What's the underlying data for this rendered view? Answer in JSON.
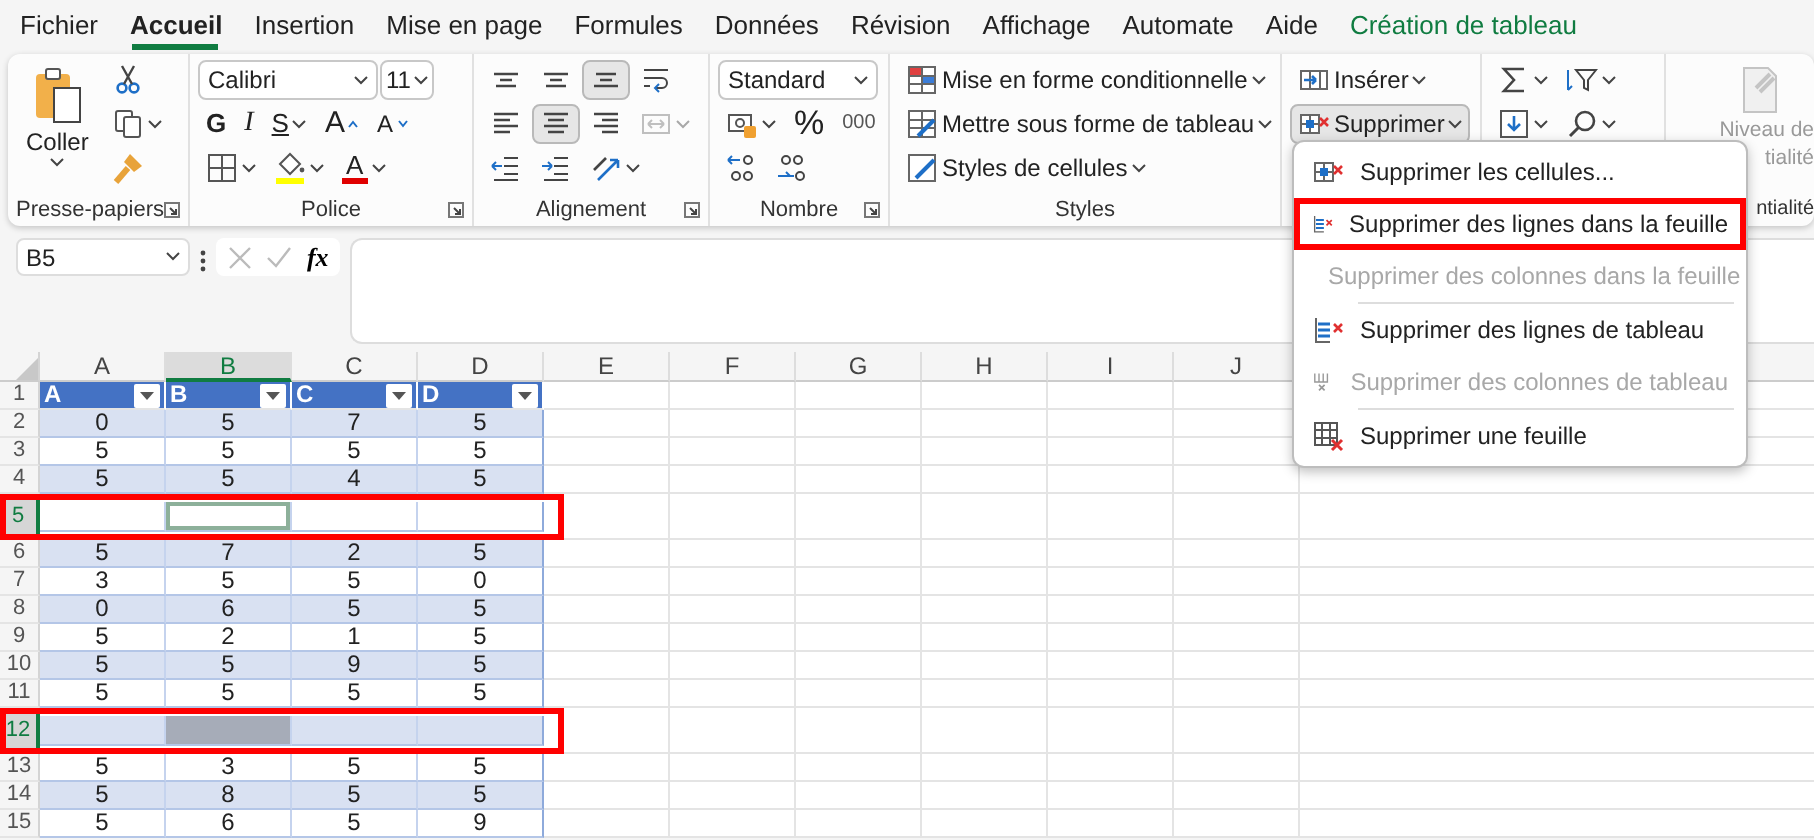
{
  "ribbon_tabs": [
    {
      "label": "Fichier",
      "selected": false,
      "kind": "standard"
    },
    {
      "label": "Accueil",
      "selected": true,
      "kind": "standard"
    },
    {
      "label": "Insertion",
      "selected": false,
      "kind": "standard"
    },
    {
      "label": "Mise en page",
      "selected": false,
      "kind": "standard"
    },
    {
      "label": "Formules",
      "selected": false,
      "kind": "standard"
    },
    {
      "label": "Données",
      "selected": false,
      "kind": "standard"
    },
    {
      "label": "Révision",
      "selected": false,
      "kind": "standard"
    },
    {
      "label": "Affichage",
      "selected": false,
      "kind": "standard"
    },
    {
      "label": "Automate",
      "selected": false,
      "kind": "standard"
    },
    {
      "label": "Aide",
      "selected": false,
      "kind": "standard"
    },
    {
      "label": "Création de tableau",
      "selected": false,
      "kind": "contextual"
    }
  ],
  "clipboard": {
    "paste_label": "Coller",
    "tools": [
      {
        "kind": "cut",
        "caret": false
      },
      {
        "kind": "copy",
        "caret": true
      },
      {
        "kind": "format-painter",
        "caret": false
      }
    ],
    "group_label": "Presse-papiers",
    "launcher": true
  },
  "font": {
    "name": "Calibri",
    "size": "11",
    "rows": [
      [
        {
          "kind": "bold",
          "label": "G",
          "caret": false
        },
        {
          "kind": "italic",
          "label": "I",
          "caret": false
        },
        {
          "kind": "underline",
          "label": "S",
          "caret": true
        },
        {
          "kind": "grow",
          "label": "A",
          "caret": false
        },
        {
          "kind": "shrink",
          "label": "A",
          "caret": false
        }
      ],
      [
        {
          "kind": "borders",
          "caret": true
        },
        {
          "kind": "fill-color",
          "caret": true
        },
        {
          "kind": "font-color",
          "label": "A",
          "caret": true
        }
      ]
    ],
    "group_label": "Police",
    "launcher": true
  },
  "alignment": {
    "rows": [
      [
        {
          "kind": "align-top",
          "caret": false,
          "selected": false,
          "disabled": false
        },
        {
          "kind": "align-middle",
          "caret": false,
          "selected": false,
          "disabled": false
        },
        {
          "kind": "align-bottom",
          "caret": false,
          "selected": true,
          "disabled": false
        },
        {
          "kind": "wrap",
          "caret": false,
          "selected": false,
          "disabled": false
        }
      ],
      [
        {
          "kind": "align-left",
          "caret": false,
          "selected": false,
          "disabled": false
        },
        {
          "kind": "align-center",
          "caret": false,
          "selected": true,
          "disabled": false
        },
        {
          "kind": "align-right",
          "caret": false,
          "selected": false,
          "disabled": false
        },
        {
          "kind": "merge",
          "caret": true,
          "selected": false,
          "disabled": true
        }
      ],
      [
        {
          "kind": "outdent",
          "caret": false,
          "selected": false,
          "disabled": false
        },
        {
          "kind": "indent",
          "caret": false,
          "selected": false,
          "disabled": false
        },
        {
          "kind": "orientation",
          "caret": true,
          "selected": false,
          "disabled": false
        }
      ]
    ],
    "group_label": "Alignement",
    "launcher": true
  },
  "number": {
    "format": "Standard",
    "rows": [
      [
        {
          "kind": "accounting",
          "caret": true
        },
        {
          "kind": "percent",
          "label": "%",
          "caret": false
        },
        {
          "kind": "thousands",
          "label": "000",
          "caret": false
        }
      ],
      [
        {
          "kind": "inc-decimal",
          "caret": false
        },
        {
          "kind": "dec-decimal",
          "caret": false
        }
      ]
    ],
    "group_label": "Nombre",
    "launcher": true
  },
  "styles": {
    "buttons": [
      {
        "kind": "cond-format",
        "label": "Mise en forme conditionnelle",
        "caret": true
      },
      {
        "kind": "table-format",
        "label": "Mettre sous forme de tableau",
        "caret": true
      },
      {
        "kind": "cell-styles",
        "label": "Styles de cellules",
        "caret": true
      }
    ],
    "group_label": "Styles",
    "launcher": false
  },
  "cells": {
    "buttons": [
      {
        "kind": "insert-cells",
        "label": "Insérer",
        "caret": true,
        "selected": false
      },
      {
        "kind": "delete-cells",
        "label": "Supprimer",
        "caret": true,
        "selected": true
      }
    ]
  },
  "editing": {
    "rows": [
      [
        {
          "kind": "sum",
          "caret": true
        },
        {
          "kind": "sort-filter",
          "caret": true
        }
      ],
      [
        {
          "kind": "fill-down",
          "caret": true
        },
        {
          "kind": "search",
          "caret": true
        }
      ]
    ]
  },
  "sensitivity": {
    "lines": [
      "Niveau de",
      "tialité"
    ],
    "group_label": "ntialité",
    "disabled": true
  },
  "formula_bar": {
    "name_box": "B5",
    "function_label": "fx"
  },
  "sheet": {
    "columns": [
      {
        "label": "A",
        "selected": false
      },
      {
        "label": "B",
        "selected": true
      },
      {
        "label": "C",
        "selected": false
      },
      {
        "label": "D",
        "selected": false
      },
      {
        "label": "E",
        "selected": false
      },
      {
        "label": "F",
        "selected": false
      },
      {
        "label": "G",
        "selected": false
      },
      {
        "label": "H",
        "selected": false
      },
      {
        "label": "I",
        "selected": false
      },
      {
        "label": "J",
        "selected": false
      }
    ],
    "rows": [
      {
        "number": "1",
        "kind": "header",
        "selected": false,
        "active": false,
        "annotated": false,
        "cells": [
          "A",
          "B",
          "C",
          "D"
        ]
      },
      {
        "number": "2",
        "kind": "data",
        "selected": false,
        "active": false,
        "annotated": false,
        "cells": [
          "0",
          "5",
          "7",
          "5"
        ]
      },
      {
        "number": "3",
        "kind": "data",
        "selected": false,
        "active": false,
        "annotated": false,
        "cells": [
          "5",
          "5",
          "5",
          "5"
        ]
      },
      {
        "number": "4",
        "kind": "data",
        "selected": false,
        "active": false,
        "annotated": false,
        "cells": [
          "5",
          "5",
          "4",
          "5"
        ]
      },
      {
        "number": "5",
        "kind": "data",
        "selected": true,
        "active": true,
        "annotated": true
      },
      {
        "number": "6",
        "kind": "data",
        "selected": false,
        "active": false,
        "annotated": false,
        "cells": [
          "5",
          "7",
          "2",
          "5"
        ]
      },
      {
        "number": "7",
        "kind": "data",
        "selected": false,
        "active": false,
        "annotated": false,
        "cells": [
          "3",
          "5",
          "5",
          "0"
        ]
      },
      {
        "number": "8",
        "kind": "data",
        "selected": false,
        "active": false,
        "annotated": false,
        "cells": [
          "0",
          "6",
          "5",
          "5"
        ]
      },
      {
        "number": "9",
        "kind": "data",
        "selected": false,
        "active": false,
        "annotated": false,
        "cells": [
          "5",
          "2",
          "1",
          "5"
        ]
      },
      {
        "number": "10",
        "kind": "data",
        "selected": false,
        "active": false,
        "annotated": false,
        "cells": [
          "5",
          "5",
          "9",
          "5"
        ]
      },
      {
        "number": "11",
        "kind": "data",
        "selected": false,
        "active": false,
        "annotated": false,
        "cells": [
          "5",
          "5",
          "5",
          "5"
        ]
      },
      {
        "number": "12",
        "kind": "data",
        "selected": true,
        "active": false,
        "annotated": true
      },
      {
        "number": "13",
        "kind": "data",
        "selected": false,
        "active": false,
        "annotated": false,
        "cells": [
          "5",
          "3",
          "5",
          "5"
        ]
      },
      {
        "number": "14",
        "kind": "data",
        "selected": false,
        "active": false,
        "annotated": false,
        "cells": [
          "5",
          "8",
          "5",
          "5"
        ]
      },
      {
        "number": "15",
        "kind": "data",
        "selected": false,
        "active": false,
        "annotated": false,
        "cells": [
          "5",
          "6",
          "5",
          "9"
        ]
      }
    ]
  },
  "delete_menu": {
    "sections": [
      [
        {
          "kind": "delete-cells",
          "label": "Supprimer les cellules...",
          "disabled": false,
          "annotated": false
        },
        {
          "kind": "delete-rows",
          "label": "Supprimer des lignes dans la feuille",
          "disabled": false,
          "annotated": true
        },
        {
          "kind": "delete-columns",
          "label": "Supprimer des colonnes dans la feuille",
          "disabled": true,
          "annotated": false
        }
      ],
      [
        {
          "kind": "delete-rows",
          "label": "Supprimer des lignes de tableau",
          "disabled": false,
          "annotated": false
        },
        {
          "kind": "delete-columns",
          "label": "Supprimer des colonnes de tableau",
          "disabled": true,
          "annotated": false
        }
      ],
      [
        {
          "kind": "delete-sheet",
          "label": "Supprimer une feuille",
          "disabled": false,
          "annotated": false
        }
      ]
    ]
  }
}
